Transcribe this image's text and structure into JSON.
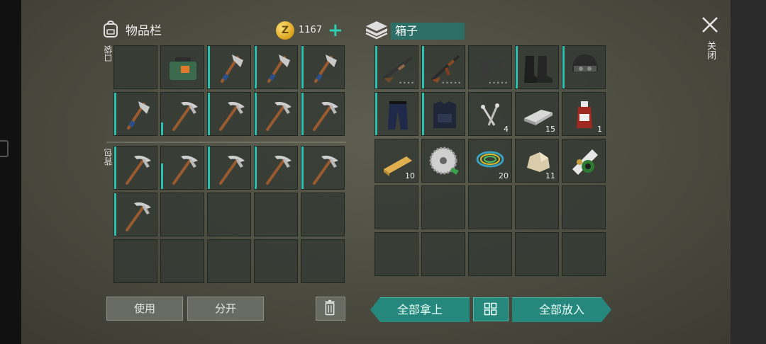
{
  "inventory": {
    "title": "物品栏",
    "pocket_label": "口袋",
    "backpack_label": "背包",
    "coins": "1167",
    "coin_symbol": "Z",
    "plus": "+",
    "pocket_slots": [
      {
        "item": "empty-icon"
      },
      {
        "item": "ammo-crate-icon"
      },
      {
        "item": "axe-icon",
        "bar": 1.0
      },
      {
        "item": "axe-icon",
        "bar": 1.0
      },
      {
        "item": "axe-icon",
        "bar": 1.0
      },
      {
        "item": "axe-icon",
        "bar": 1.0
      },
      {
        "item": "pickaxe-icon",
        "bar": 0.3
      },
      {
        "item": "pickaxe-icon",
        "bar": 1.0
      },
      {
        "item": "pickaxe-icon",
        "bar": 1.0
      },
      {
        "item": "pickaxe-icon",
        "bar": 1.0
      }
    ],
    "backpack_slots": [
      {
        "item": "pickaxe-icon",
        "bar": 1.0
      },
      {
        "item": "pickaxe-icon",
        "bar": 0.6
      },
      {
        "item": "pickaxe-icon",
        "bar": 1.0
      },
      {
        "item": "pickaxe-icon",
        "bar": 1.0
      },
      {
        "item": "pickaxe-icon",
        "bar": 1.0
      },
      {
        "item": "pickaxe-icon",
        "bar": 1.0
      },
      {
        "item": "empty-icon"
      },
      {
        "item": "empty-icon"
      },
      {
        "item": "empty-icon"
      },
      {
        "item": "empty-icon"
      },
      {
        "item": "empty-icon"
      },
      {
        "item": "empty-icon"
      },
      {
        "item": "empty-icon"
      },
      {
        "item": "empty-icon"
      },
      {
        "item": "empty-icon"
      }
    ],
    "use_button": "使用",
    "split_button": "分开"
  },
  "box": {
    "title": "箱子",
    "slots": [
      {
        "item": "shotgun-icon",
        "bar": 1.0,
        "dots": "••••"
      },
      {
        "item": "assault-rifle-icon",
        "bar": 1.0,
        "dots": "•••••"
      },
      {
        "item": "pistol-icon",
        "dots": "•••••"
      },
      {
        "item": "boots-icon",
        "bar": 1.0
      },
      {
        "item": "helmet-icon",
        "bar": 1.0
      },
      {
        "item": "pants-icon",
        "bar": 1.0
      },
      {
        "item": "armor-vest-icon",
        "bar": 1.0
      },
      {
        "item": "nails-icon",
        "count": "4"
      },
      {
        "item": "iron-bar-icon",
        "count": "15"
      },
      {
        "item": "medicine-bottle-icon",
        "count": "1"
      },
      {
        "item": "wood-plank-icon",
        "count": "10"
      },
      {
        "item": "saw-blade-icon"
      },
      {
        "item": "wire-icon",
        "count": "20"
      },
      {
        "item": "stone-icon",
        "count": "11"
      },
      {
        "item": "biohazard-scroll-icon"
      },
      {
        "item": "empty-icon"
      },
      {
        "item": "empty-icon"
      },
      {
        "item": "empty-icon"
      },
      {
        "item": "empty-icon"
      },
      {
        "item": "empty-icon"
      },
      {
        "item": "empty-icon"
      },
      {
        "item": "empty-icon"
      },
      {
        "item": "empty-icon"
      },
      {
        "item": "empty-icon"
      },
      {
        "item": "empty-icon"
      }
    ],
    "take_all_button": "全部拿上",
    "put_all_button": "全部放入"
  },
  "close_label": "关闭",
  "colors": {
    "accent": "#26887c",
    "bar": "#2bc0b0",
    "coin": "#d9a21b"
  }
}
